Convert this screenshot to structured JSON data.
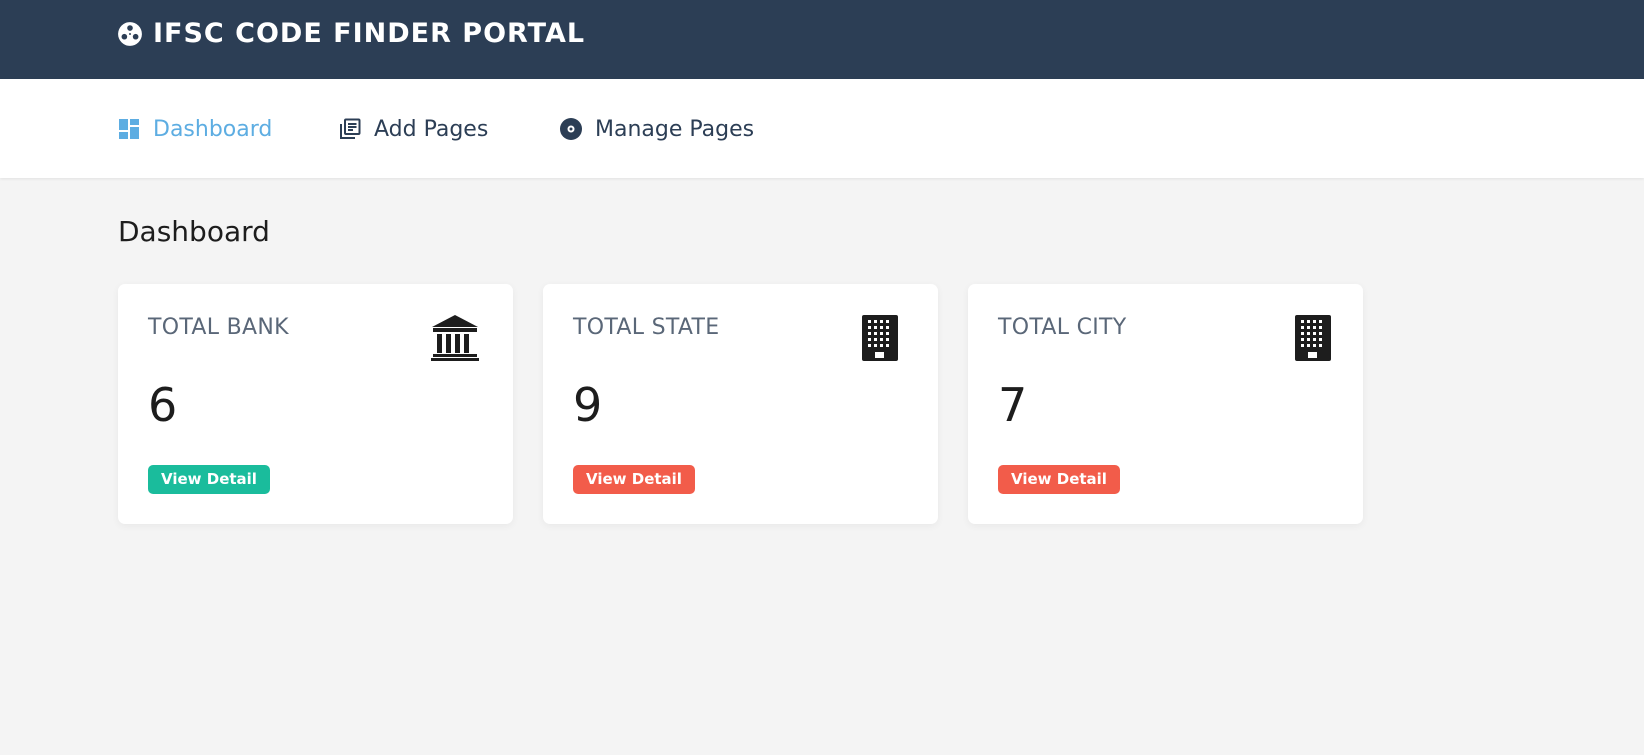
{
  "header": {
    "brand_icon": "film-reel-icon",
    "title": "IFSC CODE FINDER PORTAL",
    "background": "#2c3e55"
  },
  "nav": {
    "items": [
      {
        "label": "Dashboard",
        "icon": "dashboard-icon",
        "active": true
      },
      {
        "label": "Add Pages",
        "icon": "library-books-icon",
        "active": false
      },
      {
        "label": "Manage Pages",
        "icon": "disc-icon",
        "active": false
      }
    ],
    "active_color": "#5dade2"
  },
  "main": {
    "title": "Dashboard",
    "cards": [
      {
        "label": "TOTAL BANK",
        "value": "6",
        "icon": "bank-icon",
        "button": "View Detail",
        "button_color": "#1abc9c"
      },
      {
        "label": "TOTAL STATE",
        "value": "9",
        "icon": "building-icon",
        "button": "View Detail",
        "button_color": "#f25c4a"
      },
      {
        "label": "TOTAL CITY",
        "value": "7",
        "icon": "building-icon",
        "button": "View Detail",
        "button_color": "#f25c4a"
      }
    ]
  }
}
